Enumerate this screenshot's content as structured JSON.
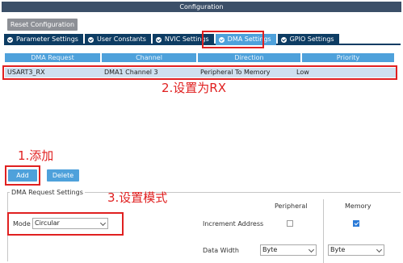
{
  "window": {
    "title": "Configuration"
  },
  "toolbar": {
    "reset_label": "Reset Configuration"
  },
  "tabs": [
    {
      "label": "Parameter Settings",
      "active": false
    },
    {
      "label": "User Constants",
      "active": false
    },
    {
      "label": "NVIC Settings",
      "active": false
    },
    {
      "label": "DMA Settings",
      "active": true
    },
    {
      "label": "GPIO Settings",
      "active": false
    }
  ],
  "dma_table": {
    "headers": [
      "DMA Request",
      "Channel",
      "Direction",
      "Priority"
    ],
    "rows": [
      [
        "USART3_RX",
        "DMA1 Channel 3",
        "Peripheral To Memory",
        "Low"
      ]
    ]
  },
  "actions": {
    "add_label": "Add",
    "delete_label": "Delete"
  },
  "annotations": {
    "step1": "1.添加",
    "step2": "2.设置为RX",
    "step3": "3.设置模式"
  },
  "request_settings": {
    "legend": "DMA Request Settings",
    "peripheral_header": "Peripheral",
    "memory_header": "Memory",
    "mode_label": "Mode",
    "mode_value": "Circular",
    "increment_label": "Increment Address",
    "increment_peripheral": false,
    "increment_memory": true,
    "width_label": "Data Width",
    "peripheral_width": "Byte",
    "memory_width": "Byte"
  },
  "colors": {
    "annotation": "#e02020",
    "tab": "#0d3c63",
    "tab_active": "#4ea1db",
    "button": "#4ea1db"
  }
}
